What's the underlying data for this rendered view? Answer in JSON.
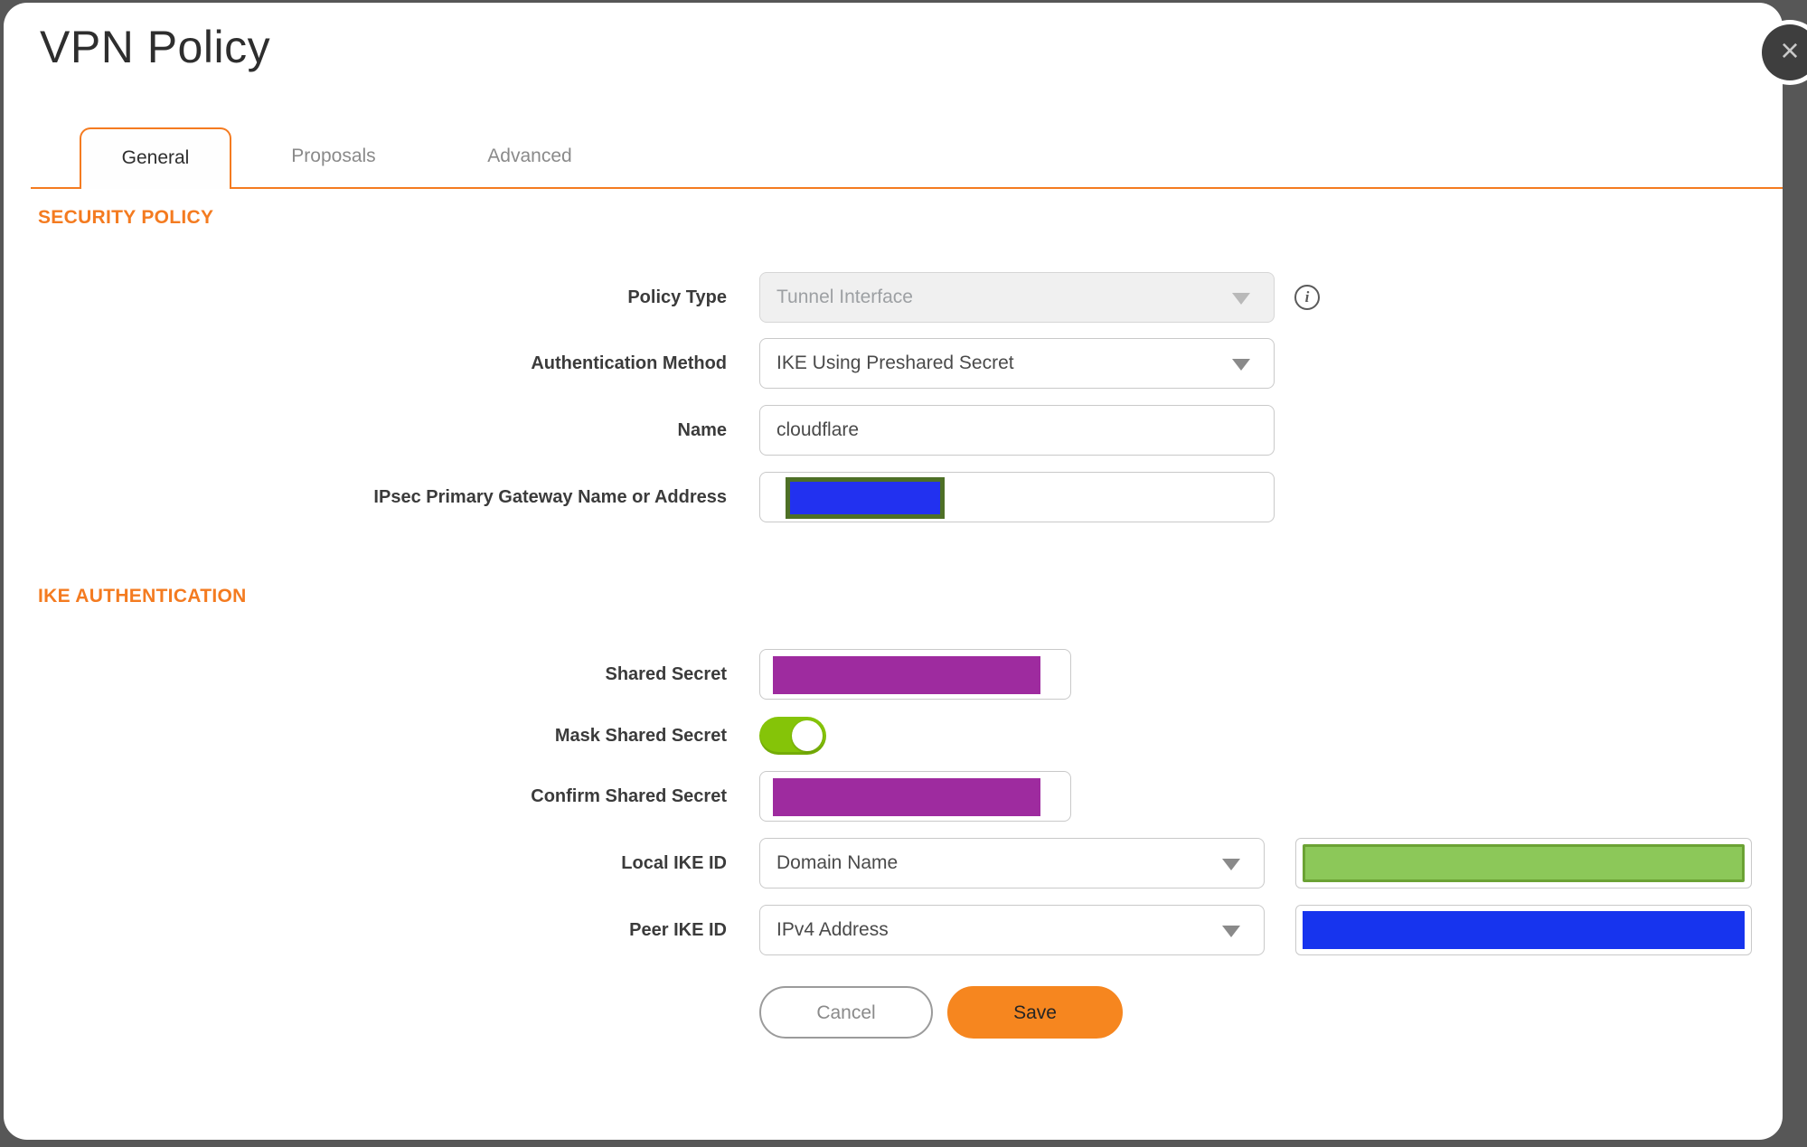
{
  "dialog": {
    "title": "VPN Policy",
    "close_label": "×"
  },
  "tabs": [
    {
      "label": "General",
      "active": true
    },
    {
      "label": "Proposals",
      "active": false
    },
    {
      "label": "Advanced",
      "active": false
    }
  ],
  "security_policy": {
    "heading": "SECURITY POLICY",
    "policy_type": {
      "label": "Policy Type",
      "value": "Tunnel Interface",
      "disabled": true
    },
    "authentication_method": {
      "label": "Authentication Method",
      "value": "IKE Using Preshared Secret"
    },
    "name": {
      "label": "Name",
      "value": "cloudflare"
    },
    "gateway": {
      "label": "IPsec Primary Gateway Name or Address",
      "value": "",
      "redacted": true
    }
  },
  "ike_authentication": {
    "heading": "IKE AUTHENTICATION",
    "shared_secret": {
      "label": "Shared Secret",
      "redacted": true
    },
    "mask_shared_secret": {
      "label": "Mask Shared Secret",
      "on": true
    },
    "confirm_shared_secret": {
      "label": "Confirm Shared Secret",
      "redacted": true
    },
    "local_ike_id": {
      "label": "Local IKE ID",
      "value": "Domain Name",
      "value_redacted": true
    },
    "peer_ike_id": {
      "label": "Peer IKE ID",
      "value": "IPv4 Address",
      "value_redacted": true
    }
  },
  "buttons": {
    "cancel": "Cancel",
    "save": "Save"
  },
  "colors": {
    "accent_orange": "#f47b20",
    "save_orange": "#f6861f",
    "redaction_purple": "#9e2b9f",
    "redaction_blue": "#2231f0",
    "redaction_blue_border": "#4e7026",
    "redaction_green": "#8cc859",
    "redaction_green_border": "#6ba234",
    "toggle_green": "#85c408",
    "backdrop_gray": "#575757"
  }
}
